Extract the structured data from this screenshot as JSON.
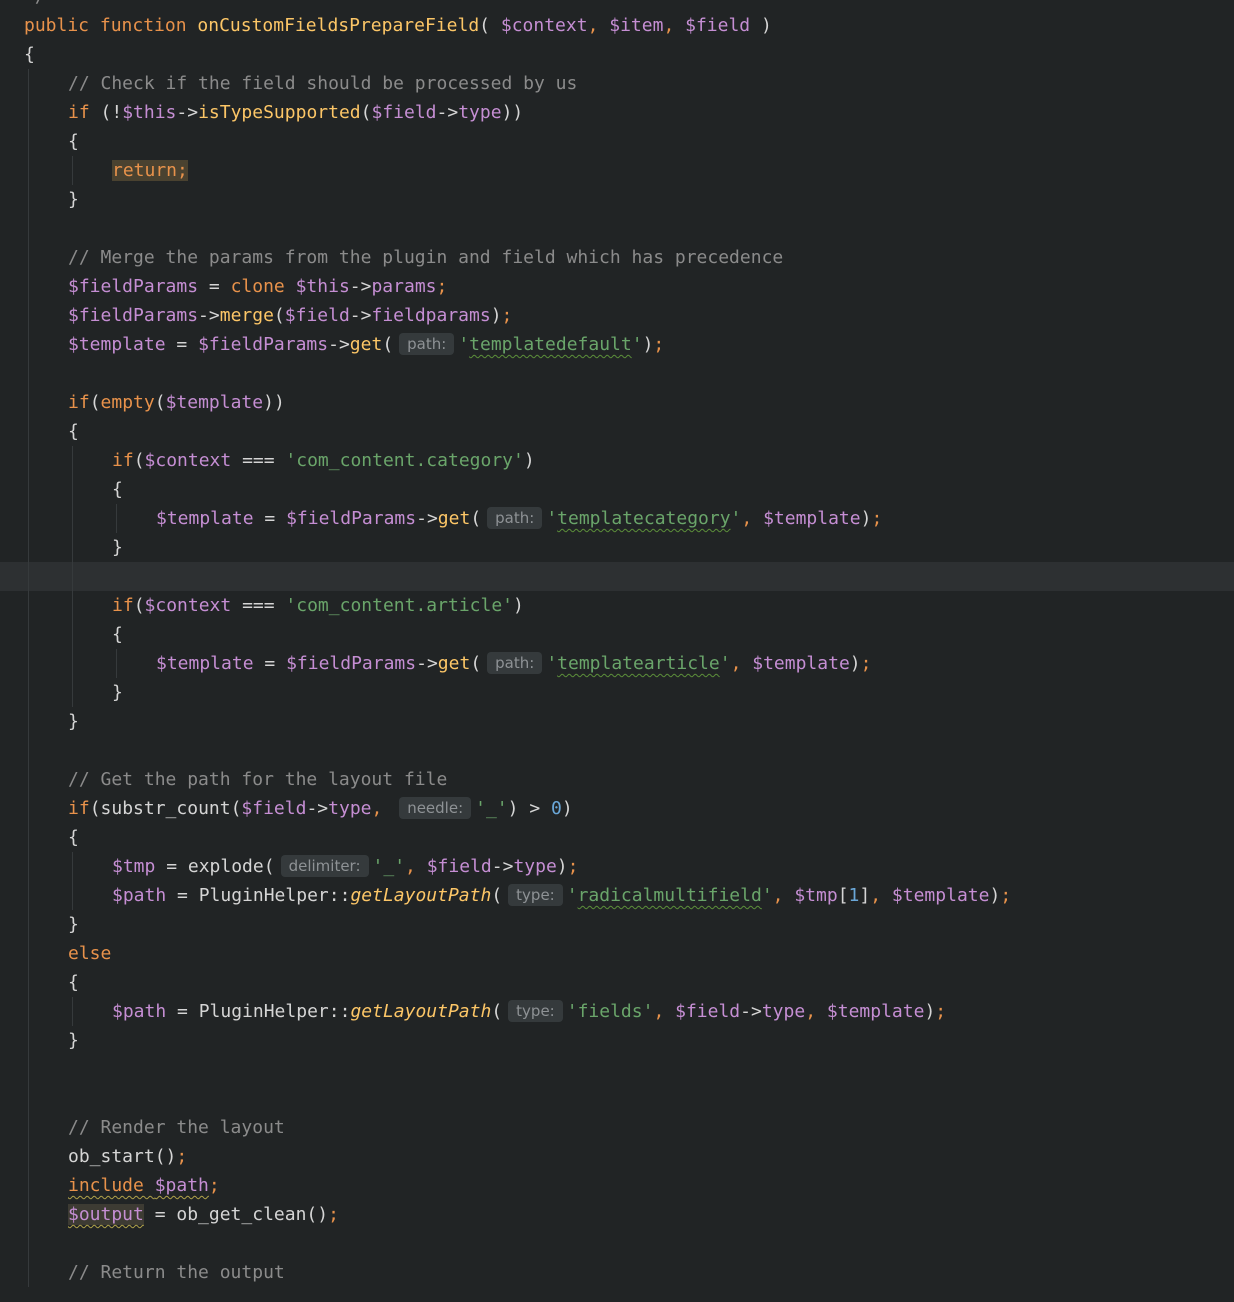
{
  "editor": {
    "lines": [
      {
        "indent": 0,
        "tokens": [
          {
            "t": "*/",
            "c": "cmt"
          }
        ]
      },
      {
        "indent": 0,
        "tokens": [
          {
            "t": "public ",
            "c": "kw"
          },
          {
            "t": "function ",
            "c": "kw"
          },
          {
            "t": "onCustomFieldsPrepareField",
            "c": "fn"
          },
          {
            "t": "( ",
            "c": "punc"
          },
          {
            "t": "$context",
            "c": "var"
          },
          {
            "t": ", ",
            "c": "semi"
          },
          {
            "t": "$item",
            "c": "var"
          },
          {
            "t": ", ",
            "c": "semi"
          },
          {
            "t": "$field",
            "c": "var"
          },
          {
            "t": " )",
            "c": "punc"
          }
        ]
      },
      {
        "indent": 0,
        "tokens": [
          {
            "t": "{",
            "c": "punc"
          }
        ]
      },
      {
        "indent": 1,
        "tokens": [
          {
            "t": "// Check if the field should be processed by us",
            "c": "cmt"
          }
        ]
      },
      {
        "indent": 1,
        "tokens": [
          {
            "t": "if ",
            "c": "kw"
          },
          {
            "t": "(!",
            "c": "punc"
          },
          {
            "t": "$this",
            "c": "var"
          },
          {
            "t": "->",
            "c": "punc"
          },
          {
            "t": "isTypeSupported",
            "c": "fn"
          },
          {
            "t": "(",
            "c": "punc"
          },
          {
            "t": "$field",
            "c": "var"
          },
          {
            "t": "->",
            "c": "punc"
          },
          {
            "t": "type",
            "c": "prop"
          },
          {
            "t": "))",
            "c": "punc"
          }
        ]
      },
      {
        "indent": 1,
        "tokens": [
          {
            "t": "{",
            "c": "punc"
          }
        ]
      },
      {
        "indent": 2,
        "tokens": [
          {
            "t": "return;",
            "c": "kw",
            "h": "hl-return"
          }
        ]
      },
      {
        "indent": 1,
        "tokens": [
          {
            "t": "}",
            "c": "punc"
          }
        ]
      },
      {
        "indent": 0,
        "tokens": []
      },
      {
        "indent": 1,
        "tokens": [
          {
            "t": "// Merge the params from the plugin and field which has precedence",
            "c": "cmt"
          }
        ]
      },
      {
        "indent": 1,
        "tokens": [
          {
            "t": "$fieldParams",
            "c": "var"
          },
          {
            "t": " = ",
            "c": "punc"
          },
          {
            "t": "clone ",
            "c": "kw"
          },
          {
            "t": "$this",
            "c": "var"
          },
          {
            "t": "->",
            "c": "punc"
          },
          {
            "t": "params",
            "c": "prop"
          },
          {
            "t": ";",
            "c": "semi"
          }
        ]
      },
      {
        "indent": 1,
        "tokens": [
          {
            "t": "$fieldParams",
            "c": "var"
          },
          {
            "t": "->",
            "c": "punc"
          },
          {
            "t": "merge",
            "c": "fn"
          },
          {
            "t": "(",
            "c": "punc"
          },
          {
            "t": "$field",
            "c": "var"
          },
          {
            "t": "->",
            "c": "punc"
          },
          {
            "t": "fieldparams",
            "c": "prop"
          },
          {
            "t": ")",
            "c": "punc"
          },
          {
            "t": ";",
            "c": "semi"
          }
        ]
      },
      {
        "indent": 1,
        "tokens": [
          {
            "t": "$template",
            "c": "var"
          },
          {
            "t": " = ",
            "c": "punc"
          },
          {
            "t": "$fieldParams",
            "c": "var"
          },
          {
            "t": "->",
            "c": "punc"
          },
          {
            "t": "get",
            "c": "fn"
          },
          {
            "t": "(",
            "c": "punc"
          },
          {
            "hint": "path:"
          },
          {
            "t": "'",
            "c": "str"
          },
          {
            "t": "templatedefault",
            "c": "str",
            "sq": "sq"
          },
          {
            "t": "'",
            "c": "str"
          },
          {
            "t": ")",
            "c": "punc"
          },
          {
            "t": ";",
            "c": "semi"
          }
        ]
      },
      {
        "indent": 0,
        "tokens": []
      },
      {
        "indent": 1,
        "tokens": [
          {
            "t": "if",
            "c": "kw"
          },
          {
            "t": "(",
            "c": "punc"
          },
          {
            "t": "empty",
            "c": "kw"
          },
          {
            "t": "(",
            "c": "punc"
          },
          {
            "t": "$template",
            "c": "var"
          },
          {
            "t": "))",
            "c": "punc"
          }
        ]
      },
      {
        "indent": 1,
        "tokens": [
          {
            "t": "{",
            "c": "punc"
          }
        ]
      },
      {
        "indent": 2,
        "tokens": [
          {
            "t": "if",
            "c": "kw"
          },
          {
            "t": "(",
            "c": "punc"
          },
          {
            "t": "$context",
            "c": "var"
          },
          {
            "t": " === ",
            "c": "punc"
          },
          {
            "t": "'com_content.category'",
            "c": "str"
          },
          {
            "t": ")",
            "c": "punc"
          }
        ]
      },
      {
        "indent": 2,
        "tokens": [
          {
            "t": "{",
            "c": "punc"
          }
        ]
      },
      {
        "indent": 3,
        "tokens": [
          {
            "t": "$template",
            "c": "var"
          },
          {
            "t": " = ",
            "c": "punc"
          },
          {
            "t": "$fieldParams",
            "c": "var"
          },
          {
            "t": "->",
            "c": "punc"
          },
          {
            "t": "get",
            "c": "fn"
          },
          {
            "t": "(",
            "c": "punc"
          },
          {
            "hint": "path:"
          },
          {
            "t": "'",
            "c": "str"
          },
          {
            "t": "templatecategory",
            "c": "str",
            "sq": "sq"
          },
          {
            "t": "'",
            "c": "str"
          },
          {
            "t": ", ",
            "c": "semi"
          },
          {
            "t": "$template",
            "c": "var"
          },
          {
            "t": ")",
            "c": "punc"
          },
          {
            "t": ";",
            "c": "semi"
          }
        ]
      },
      {
        "indent": 2,
        "tokens": [
          {
            "t": "}",
            "c": "punc"
          }
        ]
      },
      {
        "indent": 0,
        "tokens": [],
        "current": true
      },
      {
        "indent": 2,
        "tokens": [
          {
            "t": "if",
            "c": "kw"
          },
          {
            "t": "(",
            "c": "punc"
          },
          {
            "t": "$context",
            "c": "var"
          },
          {
            "t": " === ",
            "c": "punc"
          },
          {
            "t": "'com_content.article'",
            "c": "str"
          },
          {
            "t": ")",
            "c": "punc"
          }
        ]
      },
      {
        "indent": 2,
        "tokens": [
          {
            "t": "{",
            "c": "punc"
          }
        ]
      },
      {
        "indent": 3,
        "tokens": [
          {
            "t": "$template",
            "c": "var"
          },
          {
            "t": " = ",
            "c": "punc"
          },
          {
            "t": "$fieldParams",
            "c": "var"
          },
          {
            "t": "->",
            "c": "punc"
          },
          {
            "t": "get",
            "c": "fn"
          },
          {
            "t": "(",
            "c": "punc"
          },
          {
            "hint": "path:"
          },
          {
            "t": "'",
            "c": "str"
          },
          {
            "t": "templatearticle",
            "c": "str",
            "sq": "sq"
          },
          {
            "t": "'",
            "c": "str"
          },
          {
            "t": ", ",
            "c": "semi"
          },
          {
            "t": "$template",
            "c": "var"
          },
          {
            "t": ")",
            "c": "punc"
          },
          {
            "t": ";",
            "c": "semi"
          }
        ]
      },
      {
        "indent": 2,
        "tokens": [
          {
            "t": "}",
            "c": "punc"
          }
        ]
      },
      {
        "indent": 1,
        "tokens": [
          {
            "t": "}",
            "c": "punc"
          }
        ]
      },
      {
        "indent": 0,
        "tokens": []
      },
      {
        "indent": 1,
        "tokens": [
          {
            "t": "// Get the path for the layout file",
            "c": "cmt"
          }
        ]
      },
      {
        "indent": 1,
        "tokens": [
          {
            "t": "if",
            "c": "kw"
          },
          {
            "t": "(",
            "c": "punc"
          },
          {
            "t": "substr_count",
            "c": "plain"
          },
          {
            "t": "(",
            "c": "punc"
          },
          {
            "t": "$field",
            "c": "var"
          },
          {
            "t": "->",
            "c": "punc"
          },
          {
            "t": "type",
            "c": "prop"
          },
          {
            "t": ", ",
            "c": "semi"
          },
          {
            "hint": "needle:"
          },
          {
            "t": "'_'",
            "c": "str"
          },
          {
            "t": ") > ",
            "c": "punc"
          },
          {
            "t": "0",
            "c": "num"
          },
          {
            "t": ")",
            "c": "punc"
          }
        ]
      },
      {
        "indent": 1,
        "tokens": [
          {
            "t": "{",
            "c": "punc"
          }
        ]
      },
      {
        "indent": 2,
        "tokens": [
          {
            "t": "$tmp",
            "c": "var"
          },
          {
            "t": " = ",
            "c": "punc"
          },
          {
            "t": "explode",
            "c": "plain"
          },
          {
            "t": "(",
            "c": "punc"
          },
          {
            "hint": "delimiter:"
          },
          {
            "t": "'_'",
            "c": "str"
          },
          {
            "t": ", ",
            "c": "semi"
          },
          {
            "t": "$field",
            "c": "var"
          },
          {
            "t": "->",
            "c": "punc"
          },
          {
            "t": "type",
            "c": "prop"
          },
          {
            "t": ")",
            "c": "punc"
          },
          {
            "t": ";",
            "c": "semi"
          }
        ]
      },
      {
        "indent": 2,
        "tokens": [
          {
            "t": "$path",
            "c": "var"
          },
          {
            "t": " = ",
            "c": "punc"
          },
          {
            "t": "PluginHelper",
            "c": "plain"
          },
          {
            "t": "::",
            "c": "punc"
          },
          {
            "t": "getLayoutPath",
            "c": "fni"
          },
          {
            "t": "(",
            "c": "punc"
          },
          {
            "hint": "type:"
          },
          {
            "t": "'",
            "c": "str"
          },
          {
            "t": "radicalmultifield",
            "c": "str",
            "sq": "sq"
          },
          {
            "t": "'",
            "c": "str"
          },
          {
            "t": ", ",
            "c": "semi"
          },
          {
            "t": "$tmp",
            "c": "var"
          },
          {
            "t": "[",
            "c": "punc"
          },
          {
            "t": "1",
            "c": "num"
          },
          {
            "t": "]",
            "c": "punc"
          },
          {
            "t": ", ",
            "c": "semi"
          },
          {
            "t": "$template",
            "c": "var"
          },
          {
            "t": ")",
            "c": "punc"
          },
          {
            "t": ";",
            "c": "semi"
          }
        ]
      },
      {
        "indent": 1,
        "tokens": [
          {
            "t": "}",
            "c": "punc"
          }
        ]
      },
      {
        "indent": 1,
        "tokens": [
          {
            "t": "else",
            "c": "kw"
          }
        ]
      },
      {
        "indent": 1,
        "tokens": [
          {
            "t": "{",
            "c": "punc"
          }
        ]
      },
      {
        "indent": 2,
        "tokens": [
          {
            "t": "$path",
            "c": "var"
          },
          {
            "t": " = ",
            "c": "punc"
          },
          {
            "t": "PluginHelper",
            "c": "plain"
          },
          {
            "t": "::",
            "c": "punc"
          },
          {
            "t": "getLayoutPath",
            "c": "fni"
          },
          {
            "t": "(",
            "c": "punc"
          },
          {
            "hint": "type:"
          },
          {
            "t": "'fields'",
            "c": "str"
          },
          {
            "t": ", ",
            "c": "semi"
          },
          {
            "t": "$field",
            "c": "var"
          },
          {
            "t": "->",
            "c": "punc"
          },
          {
            "t": "type",
            "c": "prop"
          },
          {
            "t": ", ",
            "c": "semi"
          },
          {
            "t": "$template",
            "c": "var"
          },
          {
            "t": ")",
            "c": "punc"
          },
          {
            "t": ";",
            "c": "semi"
          }
        ]
      },
      {
        "indent": 1,
        "tokens": [
          {
            "t": "}",
            "c": "punc"
          }
        ]
      },
      {
        "indent": 0,
        "tokens": []
      },
      {
        "indent": 0,
        "tokens": []
      },
      {
        "indent": 1,
        "tokens": [
          {
            "t": "// Render the layout",
            "c": "cmt"
          }
        ]
      },
      {
        "indent": 1,
        "tokens": [
          {
            "t": "ob_start",
            "c": "plain"
          },
          {
            "t": "()",
            "c": "punc"
          },
          {
            "t": ";",
            "c": "semi"
          }
        ]
      },
      {
        "indent": 1,
        "tokens": [
          {
            "t": "include ",
            "c": "kw",
            "sq": "sqo"
          },
          {
            "t": "$path",
            "c": "var",
            "sq": "sqo"
          },
          {
            "t": ";",
            "c": "semi"
          }
        ]
      },
      {
        "indent": 1,
        "tokens": [
          {
            "t": "$output",
            "c": "var",
            "sq": "sqo",
            "h": "hl-output"
          },
          {
            "t": " = ",
            "c": "punc"
          },
          {
            "t": "ob_get_clean",
            "c": "plain"
          },
          {
            "t": "()",
            "c": "punc"
          },
          {
            "t": ";",
            "c": "semi"
          }
        ]
      },
      {
        "indent": 0,
        "tokens": []
      },
      {
        "indent": 1,
        "tokens": [
          {
            "t": "// Return the output",
            "c": "cmt"
          }
        ]
      }
    ]
  },
  "colors": {
    "background": "#212425",
    "keyword": "#e8924b",
    "function": "#fcc667",
    "variable": "#c58ed3",
    "string": "#6aa56a",
    "number": "#6aa7d8",
    "comment": "#8b8b8b"
  }
}
